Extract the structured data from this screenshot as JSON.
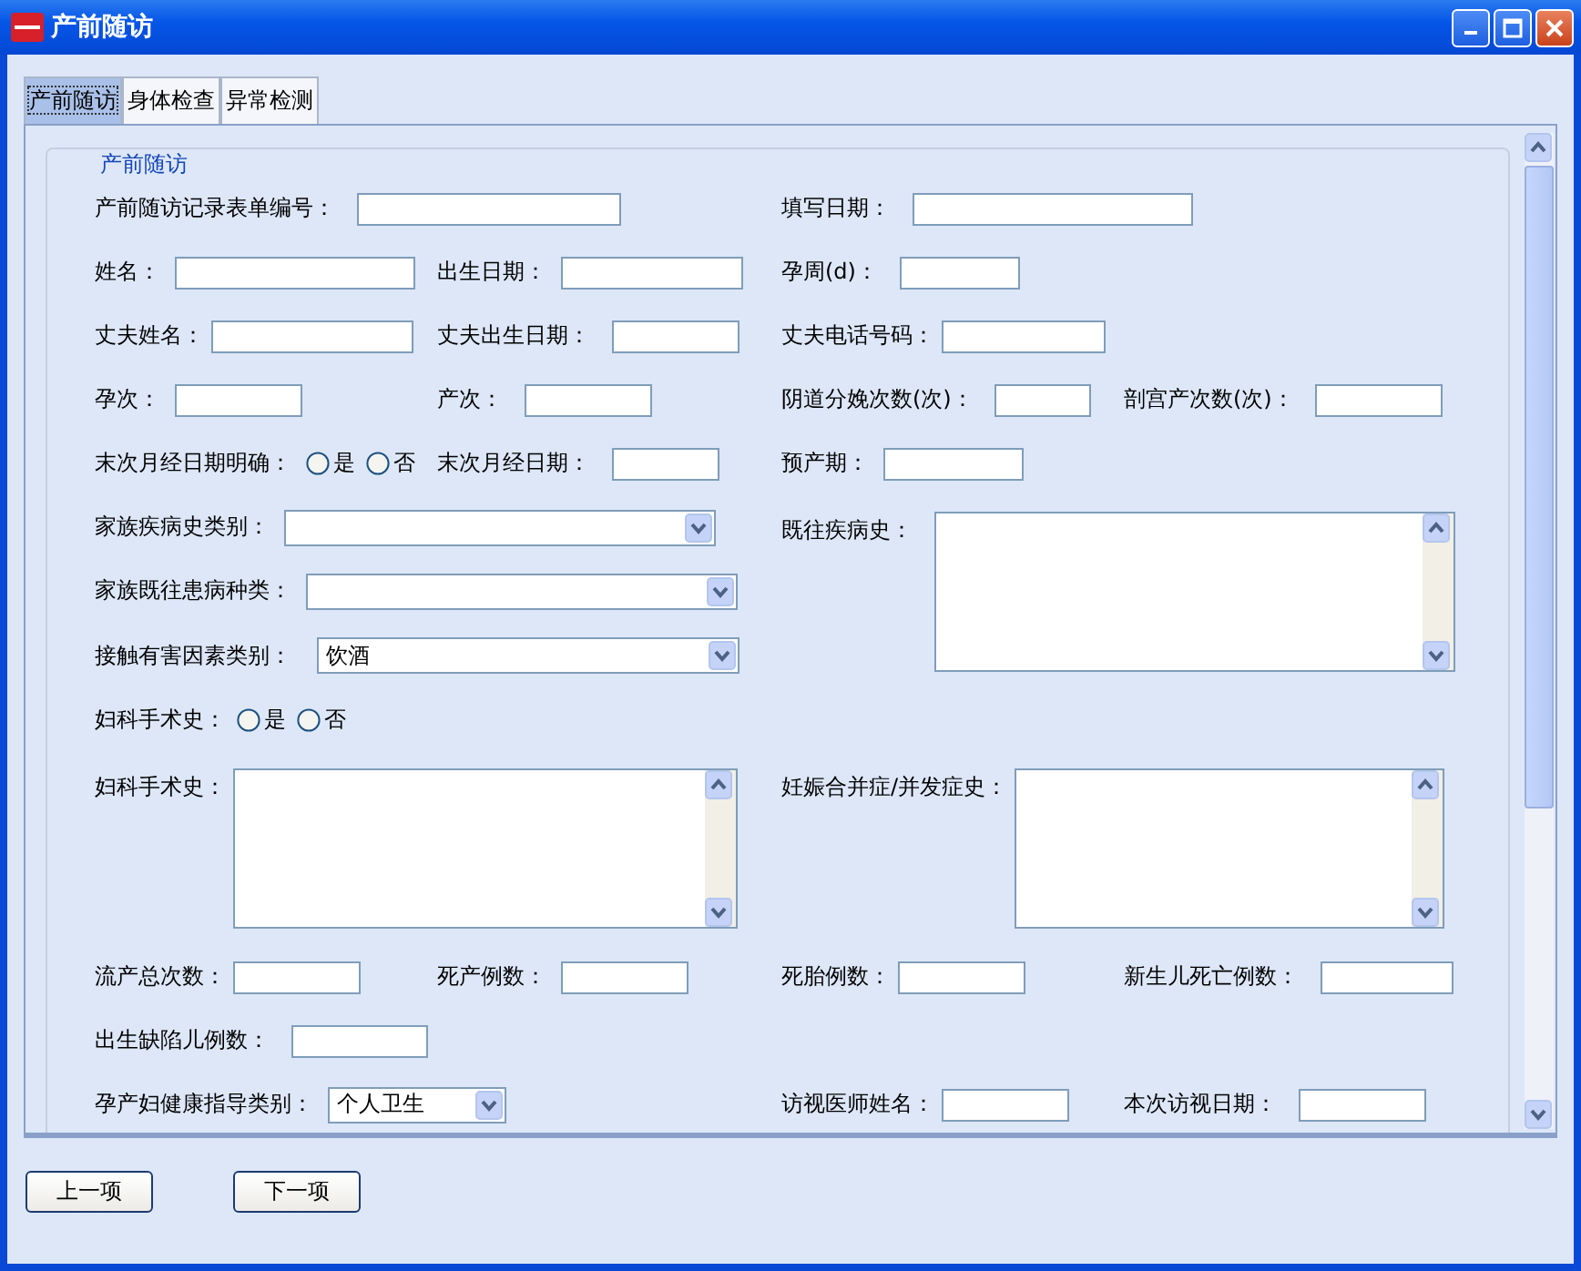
{
  "window": {
    "title": "产前随访"
  },
  "tabs": [
    {
      "label": "产前随访",
      "selected": true
    },
    {
      "label": "身体检查",
      "selected": false
    },
    {
      "label": "异常检测",
      "selected": false
    }
  ],
  "group": {
    "legend": "产前随访"
  },
  "rows": [
    [
      {
        "kind": "text",
        "label": "产前随访记录表单编号："
      },
      {
        "kind": "text",
        "label": "填写日期："
      }
    ],
    [
      {
        "kind": "text",
        "label": "姓名："
      },
      {
        "kind": "text",
        "label": "出生日期："
      },
      {
        "kind": "text",
        "label": "孕周(d)："
      }
    ],
    [
      {
        "kind": "text",
        "label": "丈夫姓名："
      },
      {
        "kind": "text",
        "label": "丈夫出生日期："
      },
      {
        "kind": "text",
        "label": "丈夫电话号码："
      }
    ],
    [
      {
        "kind": "text",
        "label": "孕次："
      },
      {
        "kind": "text",
        "label": "产次："
      },
      {
        "kind": "text",
        "label": "阴道分娩次数(次)："
      },
      {
        "kind": "text",
        "label": "剖宫产次数(次)："
      }
    ],
    [
      {
        "kind": "radio",
        "label": "末次月经日期明确：",
        "options": [
          {
            "label": "是",
            "selected": false
          },
          {
            "label": "否",
            "selected": false
          }
        ]
      },
      {
        "kind": "text",
        "label": "末次月经日期："
      },
      {
        "kind": "text",
        "label": "预产期："
      }
    ],
    [
      {
        "kind": "select",
        "label": "家族疾病史类别："
      },
      {
        "kind": "textarea",
        "label": "既往疾病史："
      }
    ],
    [
      {
        "kind": "select",
        "label": "家族既往患病种类："
      }
    ],
    [
      {
        "kind": "select",
        "label": "接触有害因素类别：",
        "value": "饮酒"
      }
    ],
    [
      {
        "kind": "radio",
        "label": "妇科手术史：",
        "options": [
          {
            "label": "是",
            "selected": false
          },
          {
            "label": "否",
            "selected": false
          }
        ]
      }
    ],
    [
      {
        "kind": "textarea",
        "label": "妇科手术史："
      },
      {
        "kind": "textarea",
        "label": "妊娠合并症/并发症史："
      }
    ],
    [
      {
        "kind": "text",
        "label": "流产总次数："
      },
      {
        "kind": "text",
        "label": "死产例数："
      },
      {
        "kind": "text",
        "label": "死胎例数："
      },
      {
        "kind": "text",
        "label": "新生儿死亡例数："
      }
    ],
    [
      {
        "kind": "text",
        "label": "出生缺陷儿例数："
      }
    ],
    [
      {
        "kind": "select",
        "label": "孕产妇健康指导类别：",
        "value": "个人卫生"
      },
      {
        "kind": "text",
        "label": "访视医师姓名："
      },
      {
        "kind": "text",
        "label": "本次访视日期："
      }
    ]
  ],
  "buttons": [
    "上一项",
    "下一项"
  ]
}
